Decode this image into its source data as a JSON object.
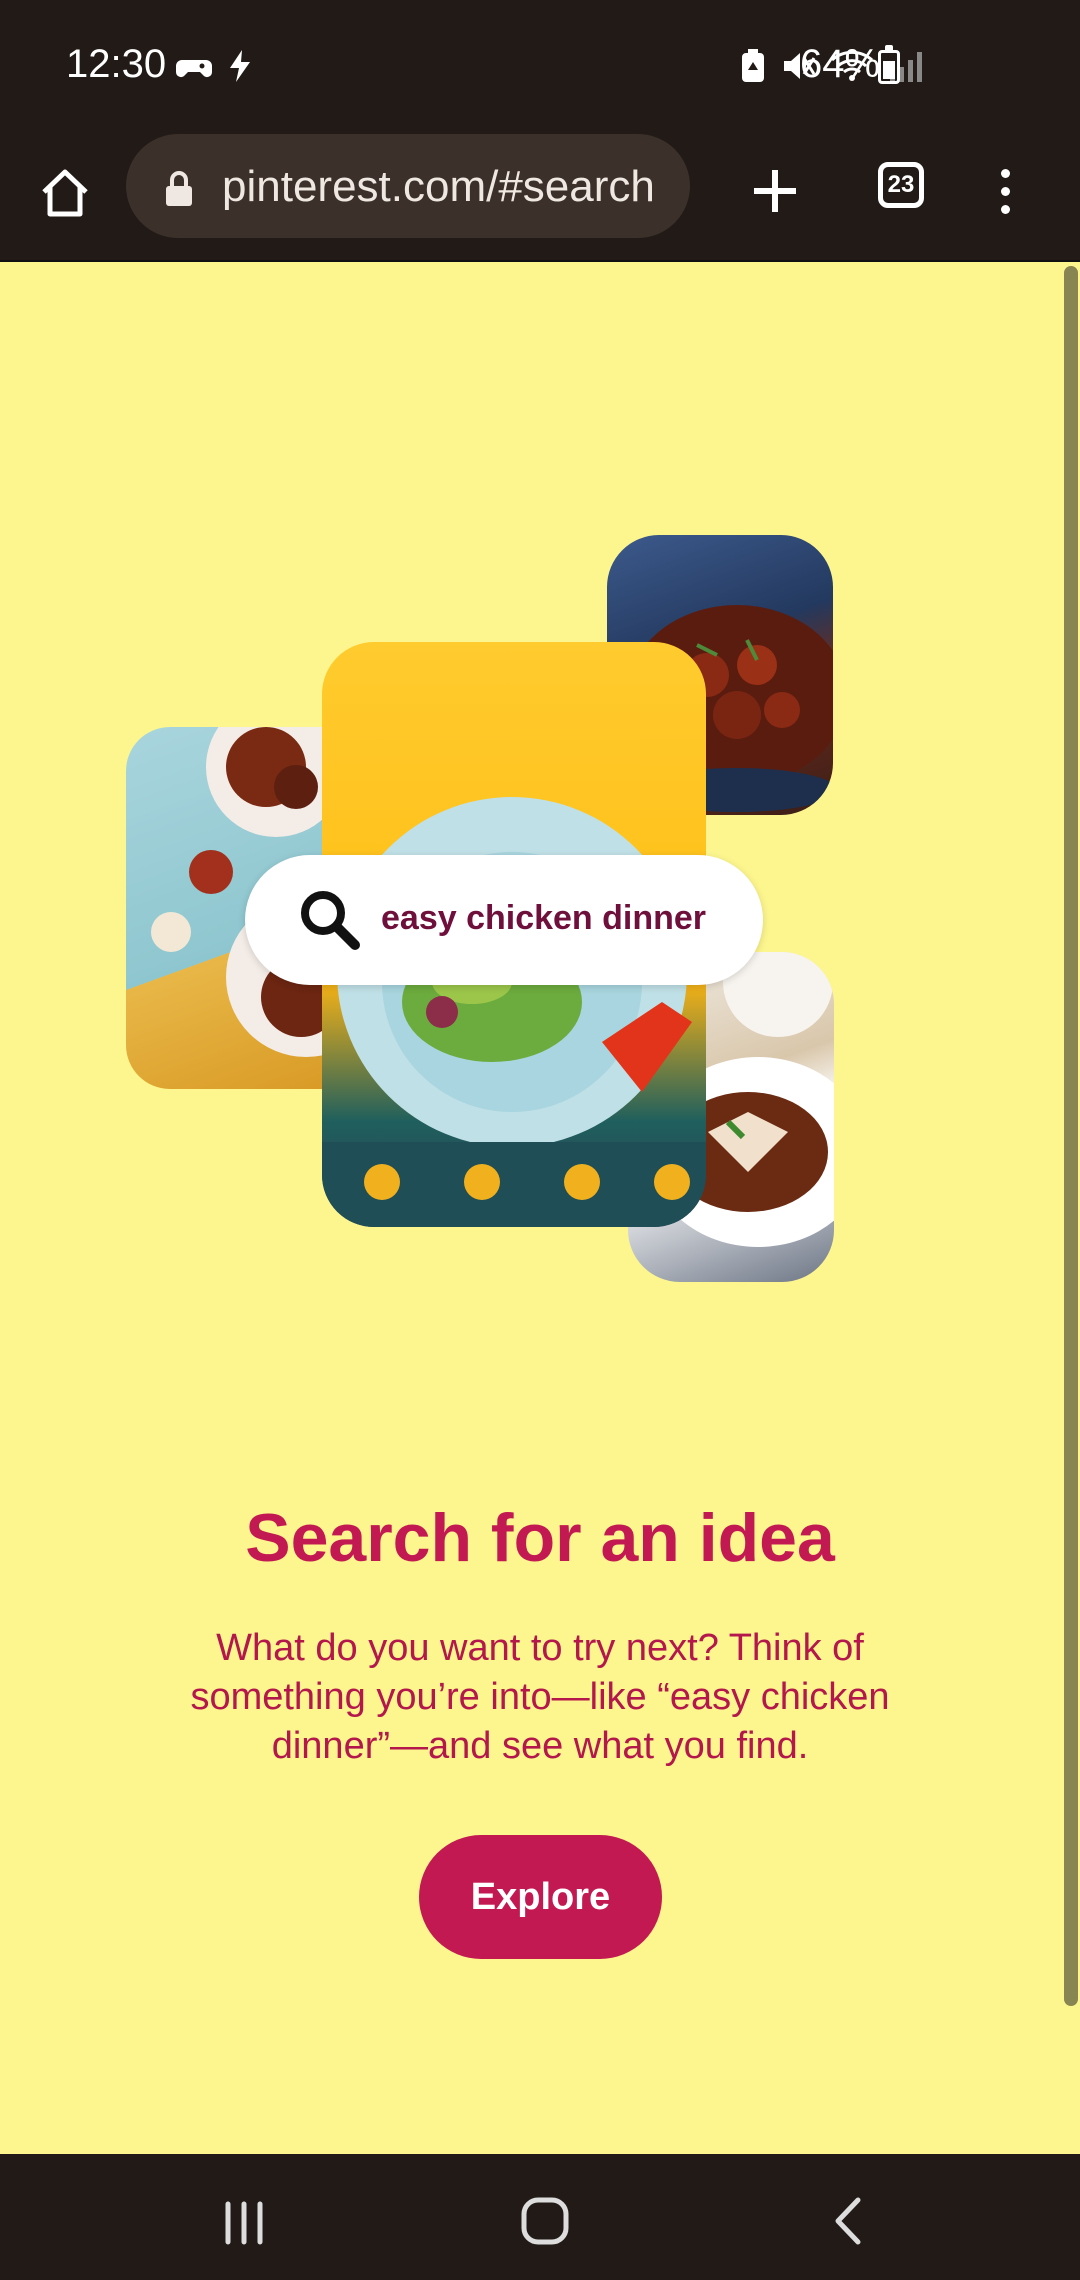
{
  "status_bar": {
    "time": "12:30",
    "battery_percent": "64%",
    "icons_left": [
      "game-controller-icon",
      "flash-icon"
    ],
    "icons_right": [
      "battery-saver-icon",
      "mute-icon",
      "wifi-icon",
      "signal-icon",
      "battery-icon"
    ],
    "battery_level": 0.64
  },
  "browser": {
    "url": "pinterest.com/#search",
    "tab_count": "23",
    "icons": [
      "home-icon",
      "lock-icon",
      "plus-icon",
      "tabs-icon",
      "more-vert-icon"
    ]
  },
  "page": {
    "background_color": "#fdf68e",
    "search_pill": {
      "query": "easy chicken dinner"
    },
    "headline": "Search for an idea",
    "body": "What do you want to try next? Think of something you’re into—like “easy chicken dinner”—and see what you find.",
    "explore_button": "Explore",
    "accent_color": "#c31952"
  },
  "nav_bar": {
    "icons": [
      "recents-icon",
      "home-circle-icon",
      "back-icon"
    ]
  }
}
